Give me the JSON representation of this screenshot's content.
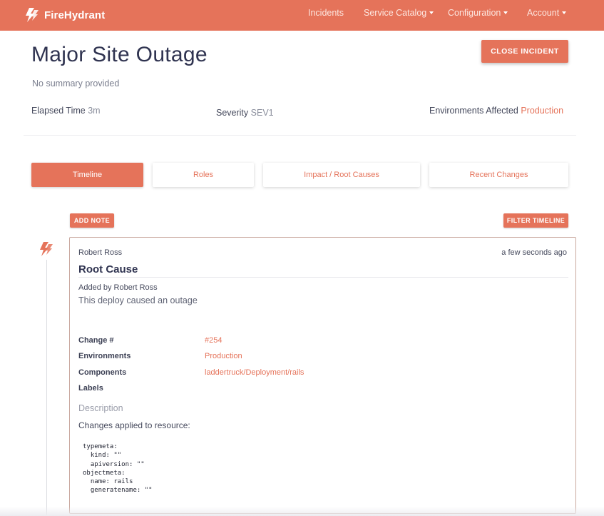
{
  "brand": {
    "name": "FireHydrant",
    "logo_icon": "firehydrant-logo-icon"
  },
  "nav": {
    "incidents": "Incidents",
    "service_catalog": "Service Catalog",
    "configuration": "Configuration",
    "account": "Account"
  },
  "incident": {
    "title": "Major Site Outage",
    "summary": "No summary provided",
    "close_label": "CLOSE INCIDENT",
    "elapsed_label": "Elapsed Time",
    "elapsed_value": "3m",
    "severity_label": "Severity",
    "severity_value": "SEV1",
    "environments_label": "Environments Affected",
    "environments_value": "Production"
  },
  "tabs": [
    {
      "label": "Timeline",
      "active": true
    },
    {
      "label": "Roles",
      "active": false
    },
    {
      "label": "Impact / Root Causes",
      "active": false
    },
    {
      "label": "Recent Changes",
      "active": false
    }
  ],
  "timeline": {
    "add_note_label": "ADD NOTE",
    "filter_label": "FILTER TIMELINE",
    "entry": {
      "author": "Robert Ross",
      "time": "a few seconds ago",
      "title": "Root Cause",
      "added_by": "Added by Robert Ross",
      "body": "This deploy caused an outage",
      "fields": [
        {
          "label": "Change #",
          "value": "#254"
        },
        {
          "label": "Environments",
          "value": "Production"
        },
        {
          "label": "Components",
          "value": "laddertruck/Deployment/rails"
        },
        {
          "label": "Labels",
          "value": ""
        }
      ],
      "description_label": "Description",
      "changes_text": "Changes applied to resource:",
      "code": "typemeta:\n  kind: \"\"\n  apiversion: \"\"\nobjectmeta:\n  name: rails\n  generatename: \"\""
    }
  },
  "colors": {
    "brand": "#e5735a",
    "text_dark": "#2f3350",
    "card_border": "#c9a89e"
  }
}
